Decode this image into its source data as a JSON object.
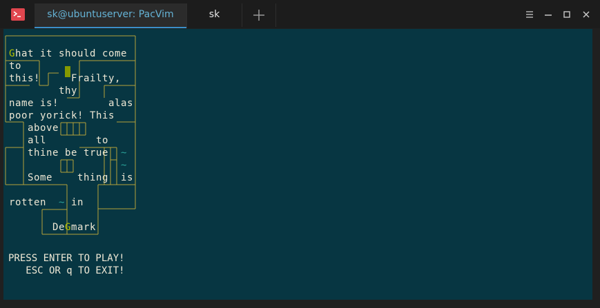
{
  "window": {
    "tabs": [
      {
        "label": "sk@ubuntuserver: PacVim",
        "active": true
      },
      {
        "label": "sk",
        "active": false
      }
    ],
    "controls": [
      "menu-icon",
      "minimize-icon",
      "maximize-icon",
      "close-icon"
    ]
  },
  "colors": {
    "terminal_bg": "#073642",
    "text": "#eee8d5",
    "wall": "#b5a33a",
    "tilde": "#2aa198",
    "ghost": "#b5c200",
    "player": "#859900",
    "app_icon": "#e0464e",
    "active_tab_text": "#65b3d6"
  },
  "board": {
    "rows": [
      "",
      "",
      "Ghat it should come",
      "to",
      "this!  ▮  Frailty,",
      "        thy",
      "name is!        alas",
      "poor yorick! This",
      "   above",
      "   all        to",
      "   thine be true  ~",
      "                  ~",
      "   Some    thing  is",
      "",
      "rotten  ~ in",
      "",
      "       DeGmark"
    ]
  },
  "messages": {
    "press_enter": "PRESS ENTER TO PLAY!",
    "esc_exit": "   ESC OR q TO EXIT!"
  }
}
